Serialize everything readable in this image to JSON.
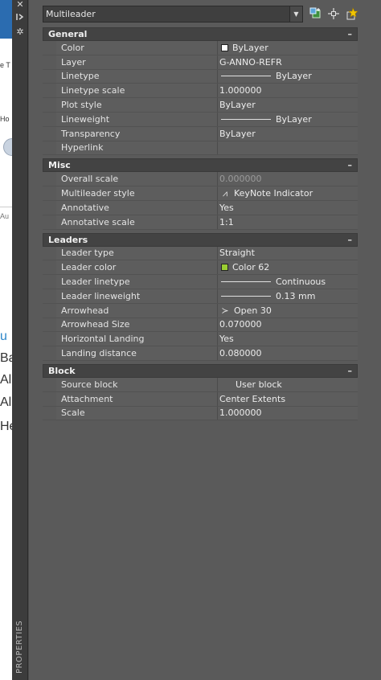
{
  "background_app": {
    "fragments": [
      "e T",
      "Ho",
      "Au",
      "u",
      "Ba",
      "Al",
      "Al",
      "He"
    ]
  },
  "sidebar": {
    "icons": [
      "close-icon",
      "auto-hide-icon",
      "settings-icon"
    ],
    "title": "PROPERTIES"
  },
  "toolbar": {
    "object_selector": "Multileader",
    "buttons": [
      "toggle-pickadd-icon",
      "select-objects-icon",
      "quick-select-icon"
    ]
  },
  "sections": [
    {
      "title": "General",
      "toggle": "–",
      "rows": [
        {
          "name": "Color",
          "value": "ByLayer",
          "kind": "swatch",
          "swatch": "#ffffff"
        },
        {
          "name": "Layer",
          "value": "G-ANNO-REFR",
          "kind": "text"
        },
        {
          "name": "Linetype",
          "value": "ByLayer",
          "kind": "line"
        },
        {
          "name": "Linetype scale",
          "value": "1.000000",
          "kind": "text"
        },
        {
          "name": "Plot style",
          "value": "ByLayer",
          "kind": "text"
        },
        {
          "name": "Lineweight",
          "value": "ByLayer",
          "kind": "line"
        },
        {
          "name": "Transparency",
          "value": "ByLayer",
          "kind": "text"
        },
        {
          "name": "Hyperlink",
          "value": "",
          "kind": "text"
        }
      ]
    },
    {
      "title": "Misc",
      "toggle": "–",
      "rows": [
        {
          "name": "Overall scale",
          "value": "0.000000",
          "kind": "dim"
        },
        {
          "name": "Multileader style",
          "value": "KeyNote Indicator",
          "kind": "glyph",
          "glyph": "⩘"
        },
        {
          "name": "Annotative",
          "value": "Yes",
          "kind": "text"
        },
        {
          "name": "Annotative scale",
          "value": "1:1",
          "kind": "text"
        }
      ]
    },
    {
      "title": "Leaders",
      "toggle": "–",
      "rows": [
        {
          "name": "Leader type",
          "value": "Straight",
          "kind": "text"
        },
        {
          "name": "Leader color",
          "value": "Color 62",
          "kind": "swatch",
          "swatch": "#9acd32"
        },
        {
          "name": "Leader linetype",
          "value": "Continuous",
          "kind": "line"
        },
        {
          "name": "Leader lineweight",
          "value": "0.13 mm",
          "kind": "line"
        },
        {
          "name": "Arrowhead",
          "value": "Open 30",
          "kind": "glyph",
          "glyph": "≻"
        },
        {
          "name": "Arrowhead Size",
          "value": "0.070000",
          "kind": "text"
        },
        {
          "name": "Horizontal Landing",
          "value": "Yes",
          "kind": "text"
        },
        {
          "name": "Landing distance",
          "value": "0.080000",
          "kind": "text"
        }
      ]
    },
    {
      "title": "Block",
      "toggle": "–",
      "rows": [
        {
          "name": "Source block",
          "value": "User block",
          "kind": "indent"
        },
        {
          "name": "Attachment",
          "value": "Center Extents",
          "kind": "text"
        },
        {
          "name": "Scale",
          "value": "1.000000",
          "kind": "text"
        }
      ]
    }
  ]
}
